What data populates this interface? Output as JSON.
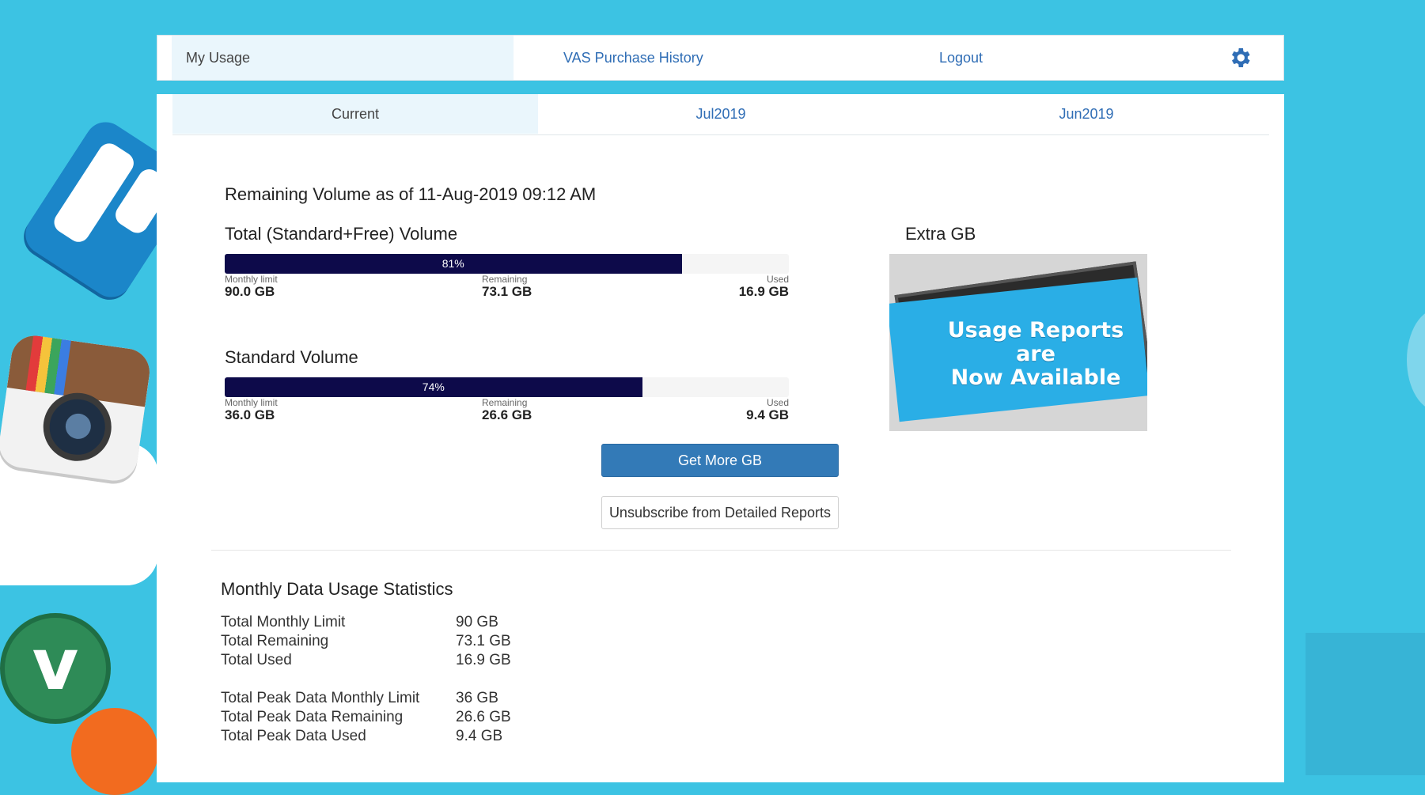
{
  "nav": {
    "tabs": [
      "My Usage",
      "VAS Purchase History",
      "Logout"
    ],
    "settings_icon": "gear-icon"
  },
  "period_tabs": [
    "Current",
    "Jul2019",
    "Jun2019"
  ],
  "remaining_heading": "Remaining Volume as of 11-Aug-2019 09:12 AM",
  "total_volume": {
    "title": "Total (Standard+Free) Volume",
    "percent": 81,
    "percent_label": "81%",
    "limit_label": "Monthly limit",
    "limit_value": "90.0 GB",
    "remaining_label": "Remaining",
    "remaining_value": "73.1 GB",
    "used_label": "Used",
    "used_value": "16.9 GB"
  },
  "standard_volume": {
    "title": "Standard Volume",
    "percent": 74,
    "percent_label": "74%",
    "limit_label": "Monthly limit",
    "limit_value": "36.0 GB",
    "remaining_label": "Remaining",
    "remaining_value": "26.6 GB",
    "used_label": "Used",
    "used_value": "9.4 GB"
  },
  "buttons": {
    "get_more": "Get More GB",
    "unsubscribe": "Unsubscribe from Detailed Reports"
  },
  "extra": {
    "title": "Extra GB",
    "promo_line1": "Usage Reports",
    "promo_line2": "are",
    "promo_line3": "Now Available"
  },
  "monthly_stats": {
    "title": "Monthly Data Usage Statistics",
    "rows": [
      {
        "label": "Total Monthly Limit",
        "value": "90 GB"
      },
      {
        "label": "Total Remaining",
        "value": "73.1 GB"
      },
      {
        "label": "Total Used",
        "value": "16.9 GB"
      },
      {
        "label": "Total Peak Data Monthly Limit",
        "value": "36 GB"
      },
      {
        "label": "Total Peak Data Remaining",
        "value": "26.6 GB"
      },
      {
        "label": "Total Peak Data Used",
        "value": "9.4 GB"
      }
    ]
  },
  "colors": {
    "background": "#3cc3e3",
    "bar_fill": "#0d0a4a",
    "primary_button": "#337ab7",
    "link": "#2f6db5"
  }
}
